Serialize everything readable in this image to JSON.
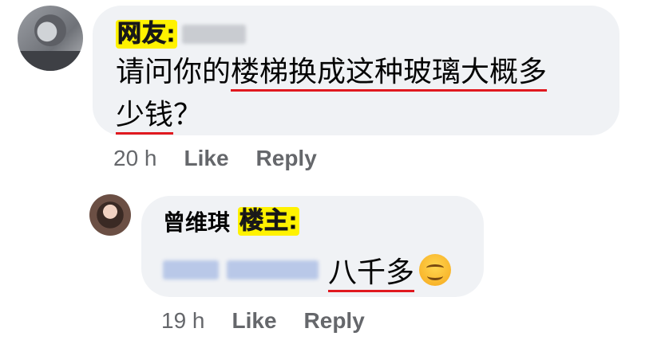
{
  "comment": {
    "author_tag": "网友:",
    "text_plain": "请问你的",
    "text_underlined": "楼梯换成这种玻璃大概多",
    "text_line2_underlined": "少钱",
    "text_line2_rest": "？",
    "time": "20 h",
    "like_label": "Like",
    "reply_label": "Reply"
  },
  "reply": {
    "author_name": "曾维琪",
    "author_tag": "楼主:",
    "text": "八千多",
    "emoji": "smiling-face-emoji",
    "time": "19 h",
    "like_label": "Like",
    "reply_label": "Reply"
  }
}
